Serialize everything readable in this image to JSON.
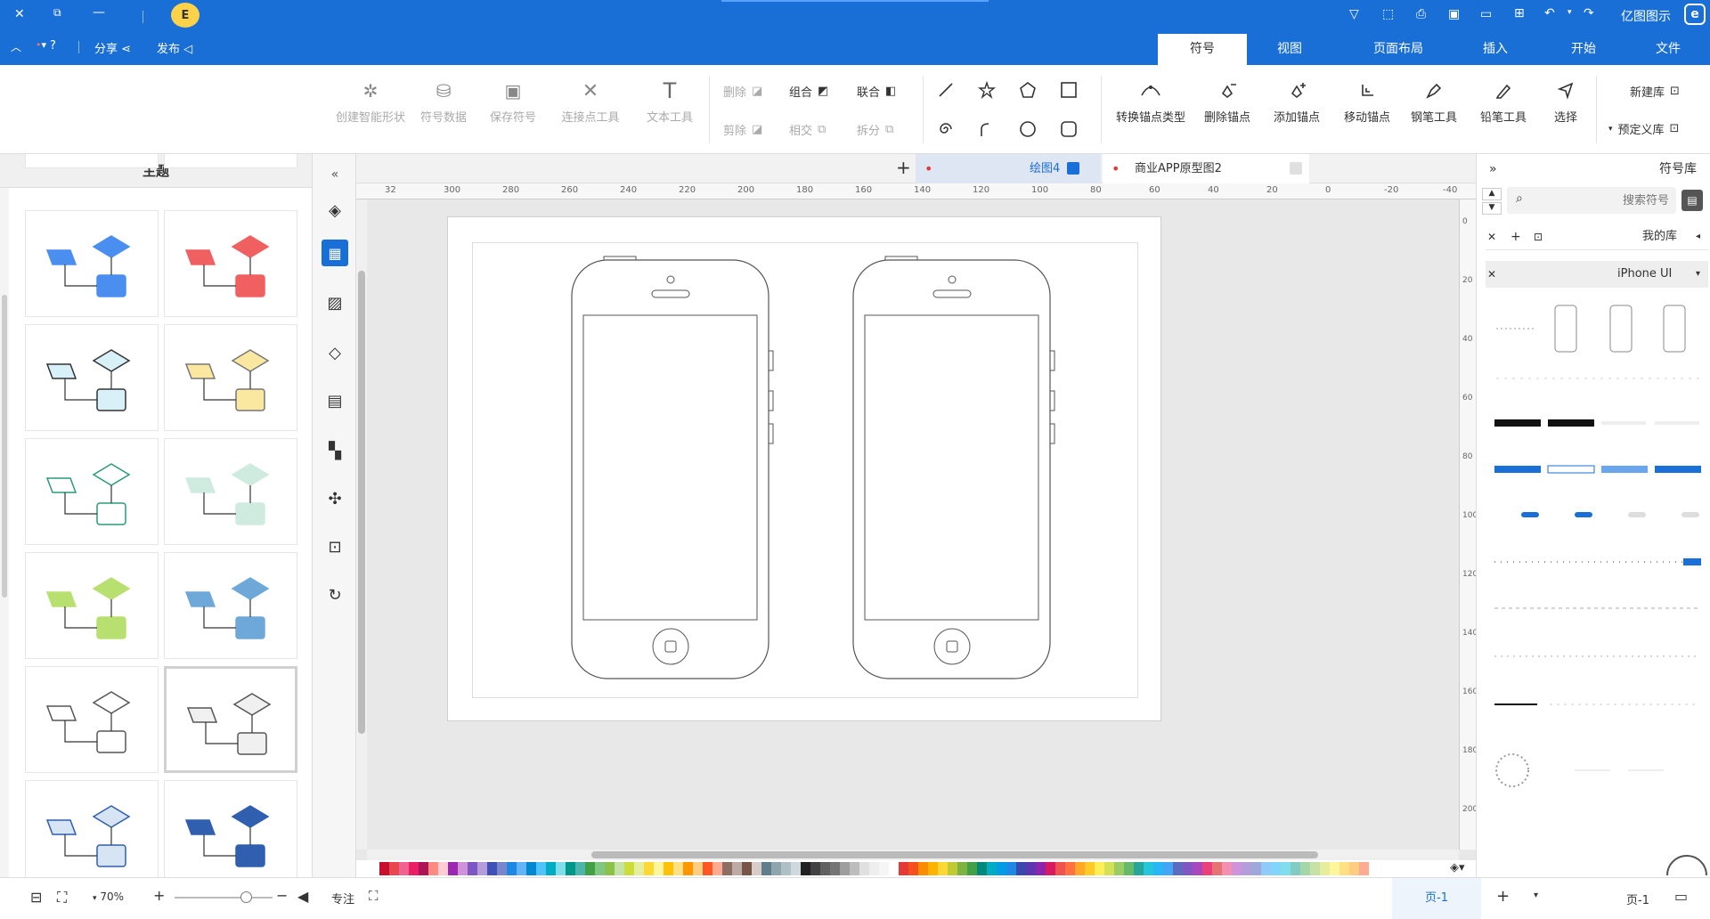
{
  "app": {
    "title": "亿图图示",
    "logo_letter": "E"
  },
  "titlebar": {
    "tabs": [
      {
        "label": "文件"
      },
      {
        "label": "开始"
      },
      {
        "label": "插入"
      },
      {
        "label": "页面布局"
      },
      {
        "label": "视图"
      },
      {
        "label": "符号"
      }
    ],
    "publish_label": "发布",
    "share_label": "分享"
  },
  "ribbon": {
    "new_lib": "新建库",
    "predefined_lib": "预定义库",
    "select": "选择",
    "pencil": "铅笔工具",
    "pen": "钢笔工具",
    "move_anchor": "移动锚点",
    "add_anchor": "添加锚点",
    "delete_anchor": "删除锚点",
    "convert_anchor": "转换锚点类型",
    "union": "联合",
    "combine": "组合",
    "subtract": "删除",
    "split": "拆分",
    "intersect": "相交",
    "trim": "剪除",
    "text_tool": "文本工具",
    "connector_tool": "连接点工具",
    "save_symbol": "保存符号",
    "symbol_data": "符号数据",
    "create_smart_shape": "创建智能形状"
  },
  "symbols_panel": {
    "title": "符号库",
    "search_placeholder": "搜索符号",
    "my_library": "我的库",
    "iphone_ui": "iPhone UI"
  },
  "doc_tabs": [
    {
      "label": "商业APP原型图2"
    },
    {
      "label": "绘图4"
    }
  ],
  "theme_panel": {
    "title": "主题"
  },
  "ruler": {
    "h_ticks": [
      "-40",
      "-20",
      "0",
      "20",
      "40",
      "60",
      "80",
      "100",
      "120",
      "140",
      "160",
      "180",
      "200",
      "220",
      "240",
      "260",
      "280",
      "300",
      "32"
    ],
    "v_ticks": [
      "0",
      "20",
      "40",
      "60",
      "80",
      "100",
      "120",
      "140",
      "160",
      "180",
      "200"
    ]
  },
  "statusbar": {
    "page_label": "页-1",
    "page_tab": "页-1",
    "focus_label": "专注",
    "zoom": "70%"
  },
  "colors": {
    "accent": "#1a6fd6",
    "swatches": [
      "#c8102e",
      "#e8474f",
      "#f06292",
      "#e91e63",
      "#ad1457",
      "#ff8a80",
      "#ffcdd2",
      "#9c27b0",
      "#ce93d8",
      "#7e57c2",
      "#b39ddb",
      "#3f51b5",
      "#7986cb",
      "#1e88e5",
      "#64b5f6",
      "#0288d1",
      "#4fc3f7",
      "#00acc1",
      "#80deea",
      "#009688",
      "#4db6ac",
      "#43a047",
      "#81c784",
      "#8bc34a",
      "#c5e1a5",
      "#cddc39",
      "#e6ee9c",
      "#fdd835",
      "#fff59d",
      "#ffc107",
      "#ffe082",
      "#ff9800",
      "#ffcc80",
      "#ff5722",
      "#ffab91",
      "#8d6e63",
      "#bcaaa4",
      "#795548",
      "#d7ccc8",
      "#607d8b",
      "#90a4ae",
      "#b0bec5",
      "#cfd8dc",
      "#212121",
      "#424242",
      "#616161",
      "#757575",
      "#9e9e9e",
      "#bdbdbd",
      "#e0e0e0",
      "#eeeeee",
      "#f5f5f5",
      "#ffffff",
      "#e53935",
      "#f4511e",
      "#fb8c00",
      "#ffb300",
      "#fdd835",
      "#c0ca33",
      "#7cb342",
      "#43a047",
      "#00897b",
      "#00acc1",
      "#039be5",
      "#1e88e5",
      "#3949ab",
      "#5e35b1",
      "#8e24aa",
      "#d81b60",
      "#ef5350",
      "#ff7043",
      "#ffa726",
      "#ffca28",
      "#ffee58",
      "#d4e157",
      "#9ccc65",
      "#66bb6a",
      "#26a69a",
      "#26c6da",
      "#29b6f6",
      "#42a5f5",
      "#5c6bc0",
      "#7e57c2",
      "#ab47bc",
      "#ec407a",
      "#e57373",
      "#f48fb1",
      "#ce93d8",
      "#b39ddb",
      "#9fa8da",
      "#90caf9",
      "#81d4fa",
      "#80deea",
      "#80cbc4",
      "#a5d6a7",
      "#c5e1a5",
      "#e6ee9c",
      "#fff59d",
      "#ffe082",
      "#ffcc80",
      "#ffab91"
    ]
  }
}
